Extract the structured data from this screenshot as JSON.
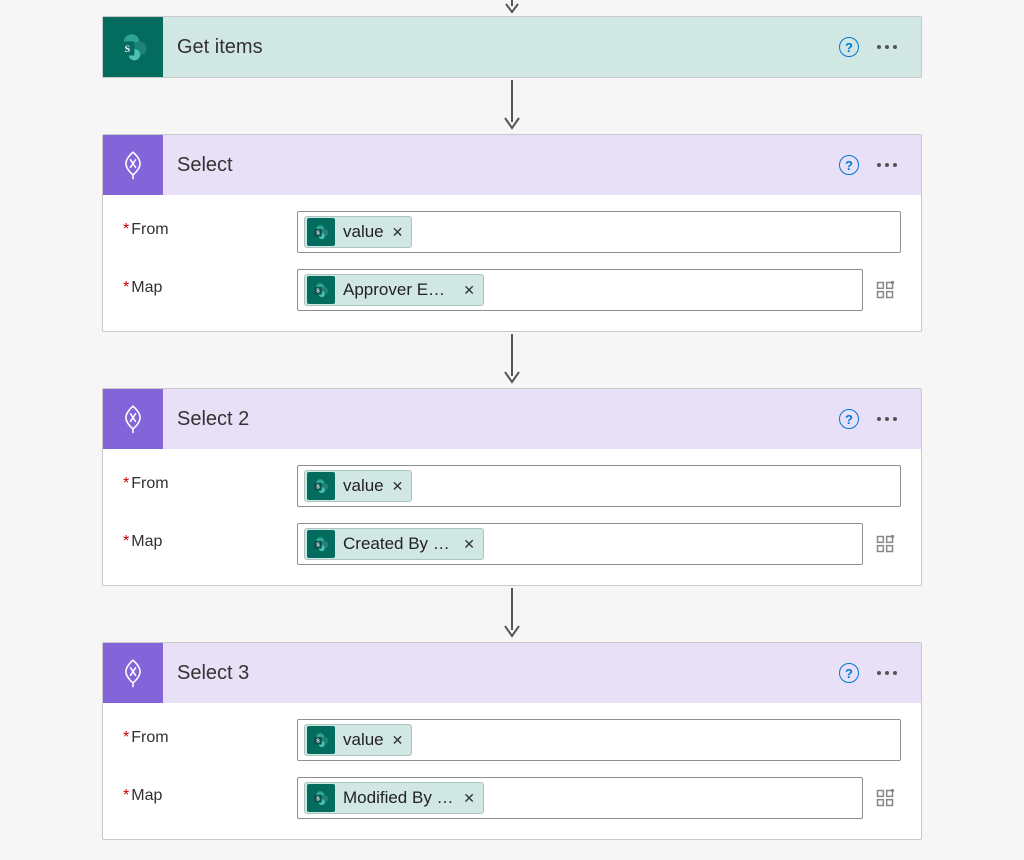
{
  "actions": {
    "get_items": {
      "title": "Get items"
    },
    "select1": {
      "title": "Select",
      "from_label": "From",
      "map_label": "Map",
      "from_token": "value",
      "map_token": "Approver Email"
    },
    "select2": {
      "title": "Select 2",
      "from_label": "From",
      "map_label": "Map",
      "from_token": "value",
      "map_token": "Created By Em…"
    },
    "select3": {
      "title": "Select 3",
      "from_label": "From",
      "map_label": "Map",
      "from_token": "value",
      "map_token": "Modified By E…"
    }
  }
}
